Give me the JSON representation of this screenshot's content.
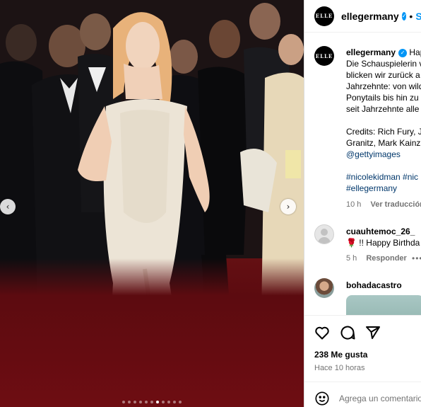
{
  "post": {
    "username": "ellegermany",
    "follow_separator": "•",
    "follow_label": "Se",
    "avatar_text": "ELLE",
    "verified_glyph": "✓"
  },
  "caption": {
    "username": "ellegermany",
    "lines": [
      "Hap",
      "Die Schauspielerin v",
      "blicken wir zurück a",
      "Jahrzehnte: von wild",
      "Ponytails bis hin zu",
      "seit Jahrzehnte alle"
    ],
    "credits_lines": [
      "Credits: Rich Fury, J",
      "Granitz, Mark Kainz"
    ],
    "credits_link": "@gettyimages",
    "hashtags_line1": "#nicolekidman #nic",
    "hashtags_line2": "#ellegermany",
    "time": "10 h",
    "translation": "Ver traducción"
  },
  "comments": [
    {
      "username": "cuauhtemoc_26_",
      "text": "🌹 !! Happy Birthda",
      "time": "5 h",
      "reply": "Responder",
      "more": "•••"
    },
    {
      "username": "bohadacastro"
    }
  ],
  "actions": {
    "like_icon": "heart-icon",
    "comment_icon": "comment-icon",
    "share_icon": "share-icon"
  },
  "likes": "238 Me gusta",
  "time_ago": "Hace 10 horas",
  "add_comment": {
    "placeholder": "Agrega un comentario"
  },
  "carousel": {
    "prev": "‹",
    "next": "›",
    "total_slides": 11,
    "active_index": 6
  },
  "colors": {
    "accent": "#0095f6",
    "muted": "#737373",
    "link": "#00376b",
    "carpet": "#6e0d12"
  }
}
